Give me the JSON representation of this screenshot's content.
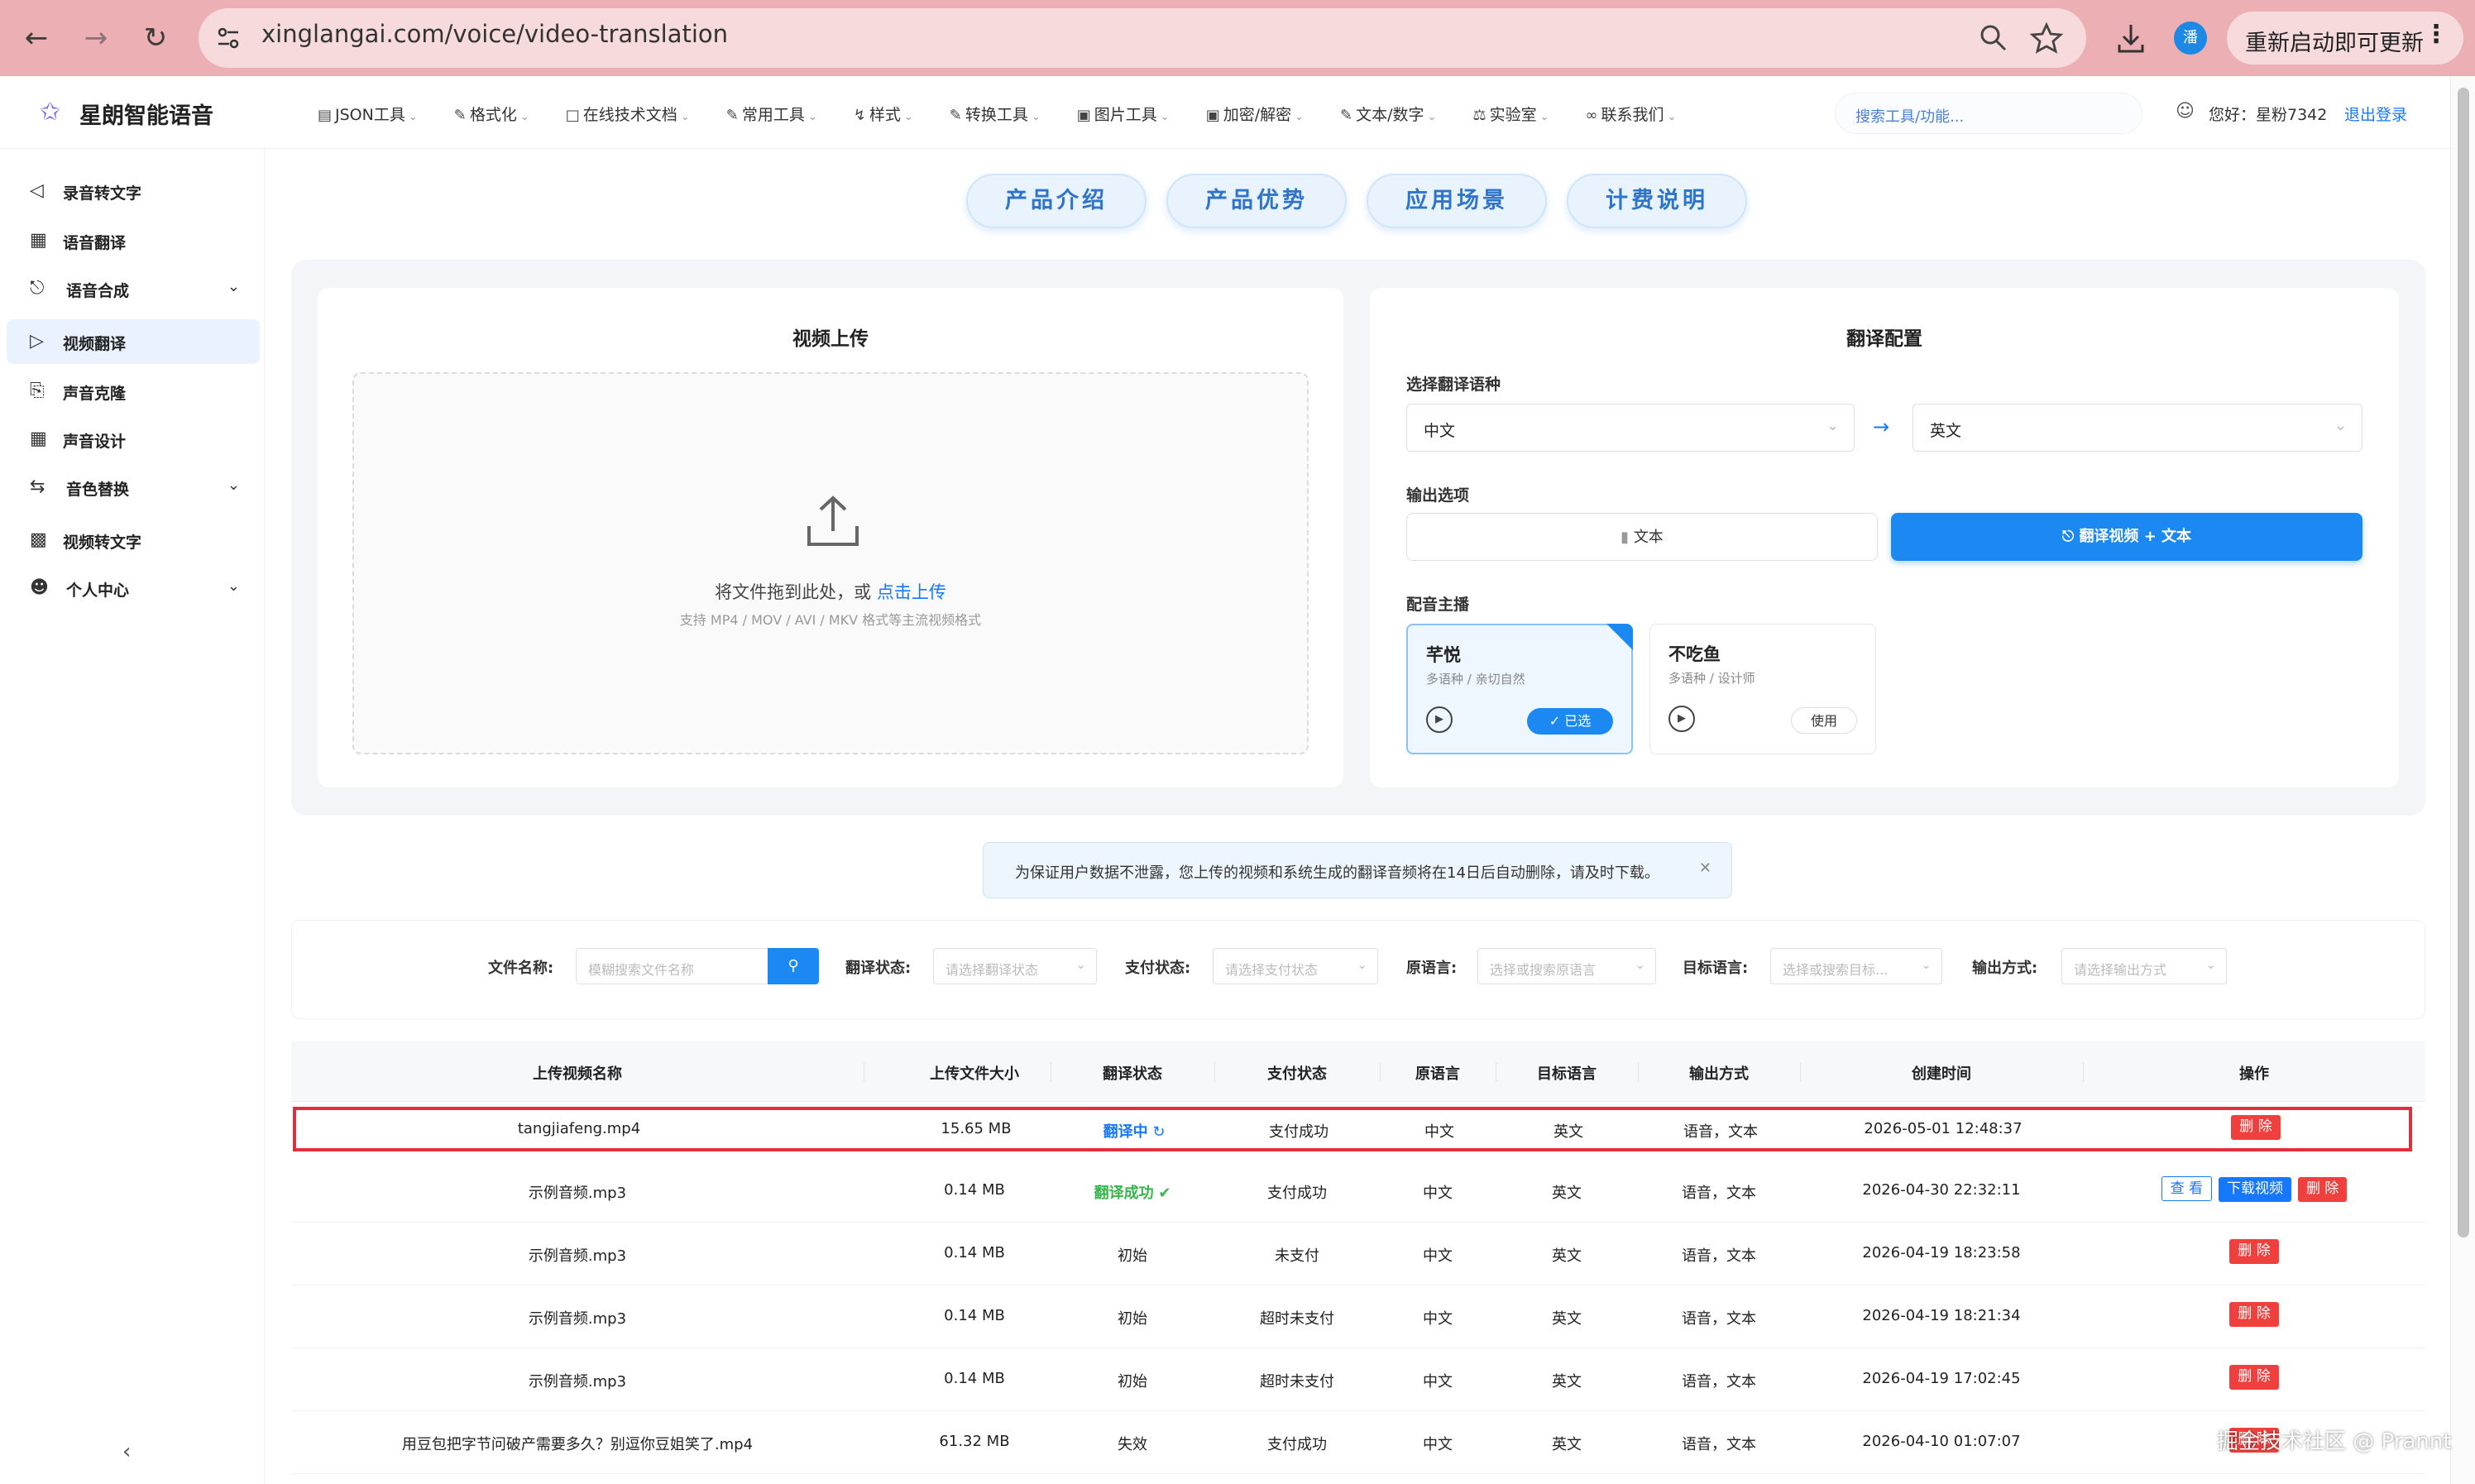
{
  "browser": {
    "url": "xinglangai.com/voice/video-translation",
    "profile_initial": "潘",
    "update_label": "重新启动即可更新"
  },
  "header": {
    "logo": "星朗智能语音",
    "menu": [
      "JSON工具",
      "格式化",
      "在线技术文档",
      "常用工具",
      "样式",
      "转换工具",
      "图片工具",
      "加密/解密",
      "文本/数字",
      "实验室",
      "联系我们"
    ],
    "search_placeholder": "搜索工具/功能...",
    "greeting": "您好：星粉7342",
    "logout": "退出登录"
  },
  "sidebar": {
    "items": [
      {
        "label": "录音转文字",
        "icon": "audio-icon",
        "expandable": false
      },
      {
        "label": "语音翻译",
        "icon": "translate-icon",
        "expandable": false
      },
      {
        "label": "语音合成",
        "icon": "mic-icon",
        "expandable": true
      },
      {
        "label": "视频翻译",
        "icon": "video-play-icon",
        "expandable": false,
        "active": true
      },
      {
        "label": "声音克隆",
        "icon": "clone-icon",
        "expandable": false
      },
      {
        "label": "声音设计",
        "icon": "design-icon",
        "expandable": false
      },
      {
        "label": "音色替换",
        "icon": "swap-icon",
        "expandable": true
      },
      {
        "label": "视频转文字",
        "icon": "video-icon",
        "expandable": false
      },
      {
        "label": "个人中心",
        "icon": "user-icon",
        "expandable": true
      }
    ]
  },
  "tabs": [
    "产品介绍",
    "产品优势",
    "应用场景",
    "计费说明"
  ],
  "upload": {
    "title": "视频上传",
    "drop_text": "将文件拖到此处，或",
    "drop_link": "点击上传",
    "hint": "支持 MP4 / MOV / AVI / MKV 格式等主流视频格式"
  },
  "config": {
    "title": "翻译配置",
    "lang_label": "选择翻译语种",
    "source_lang": "中文",
    "target_lang": "英文",
    "output_label": "输出选项",
    "output_text": "文本",
    "output_video_text": "翻译视频 + 文本",
    "voice_label": "配音主播",
    "voices": [
      {
        "name": "芊悦",
        "desc": "多语种 / 亲切自然",
        "button": "已选",
        "selected": true
      },
      {
        "name": "不吃鱼",
        "desc": "多语种 / 设计师",
        "button": "使用",
        "selected": false
      }
    ]
  },
  "notice": "为保证用户数据不泄露，您上传的视频和系统生成的翻译音频将在14日后自动删除，请及时下载。",
  "filters": {
    "file_label": "文件名称:",
    "file_placeholder": "模糊搜索文件名称",
    "status_label": "翻译状态:",
    "status_placeholder": "请选择翻译状态",
    "pay_label": "支付状态:",
    "pay_placeholder": "请选择支付状态",
    "src_label": "原语言:",
    "src_placeholder": "选择或搜索原语言",
    "tgt_label": "目标语言:",
    "tgt_placeholder": "选择或搜索目标...",
    "out_label": "输出方式:",
    "out_placeholder": "请选择输出方式"
  },
  "table": {
    "columns": [
      "上传视频名称",
      "上传文件大小",
      "翻译状态",
      "支付状态",
      "原语言",
      "目标语言",
      "输出方式",
      "创建时间",
      "操作"
    ],
    "rows": [
      {
        "name": "tangjiafeng.mp4",
        "size": "15.65 MB",
        "status": "翻译中",
        "status_type": "processing",
        "pay": "支付成功",
        "src": "中文",
        "tgt": "英文",
        "output": "语音，文本",
        "time": "2026-05-01 12:48:37",
        "actions": [
          "删 除"
        ]
      },
      {
        "name": "示例音频.mp3",
        "size": "0.14 MB",
        "status": "翻译成功",
        "status_type": "success",
        "pay": "支付成功",
        "src": "中文",
        "tgt": "英文",
        "output": "语音，文本",
        "time": "2026-04-30 22:32:11",
        "actions": [
          "查 看",
          "下载视频",
          "删 除"
        ]
      },
      {
        "name": "示例音频.mp3",
        "size": "0.14 MB",
        "status": "初始",
        "status_type": "plain",
        "pay": "未支付",
        "src": "中文",
        "tgt": "英文",
        "output": "语音，文本",
        "time": "2026-04-19 18:23:58",
        "actions": [
          "删 除"
        ]
      },
      {
        "name": "示例音频.mp3",
        "size": "0.14 MB",
        "status": "初始",
        "status_type": "plain",
        "pay": "超时未支付",
        "src": "中文",
        "tgt": "英文",
        "output": "语音，文本",
        "time": "2026-04-19 18:21:34",
        "actions": [
          "删 除"
        ]
      },
      {
        "name": "示例音频.mp3",
        "size": "0.14 MB",
        "status": "初始",
        "status_type": "plain",
        "pay": "超时未支付",
        "src": "中文",
        "tgt": "英文",
        "output": "语音，文本",
        "time": "2026-04-19 17:02:45",
        "actions": [
          "删 除"
        ]
      },
      {
        "name": "用豆包把字节问破产需要多久？别逗你豆姐笑了.mp4",
        "size": "61.32 MB",
        "status": "失效",
        "status_type": "plain",
        "pay": "支付成功",
        "src": "中文",
        "tgt": "英文",
        "output": "语音，文本",
        "time": "2026-04-10 01:07:07",
        "actions": [
          "删 除"
        ]
      }
    ]
  },
  "watermark": "掘金技术社区 @ Prannt",
  "colors": {
    "accent": "#1c89f2",
    "danger": "#f0403e",
    "success": "#35b54a",
    "browser_bar": "#ecb0b4",
    "highlight": "#e0303a"
  }
}
